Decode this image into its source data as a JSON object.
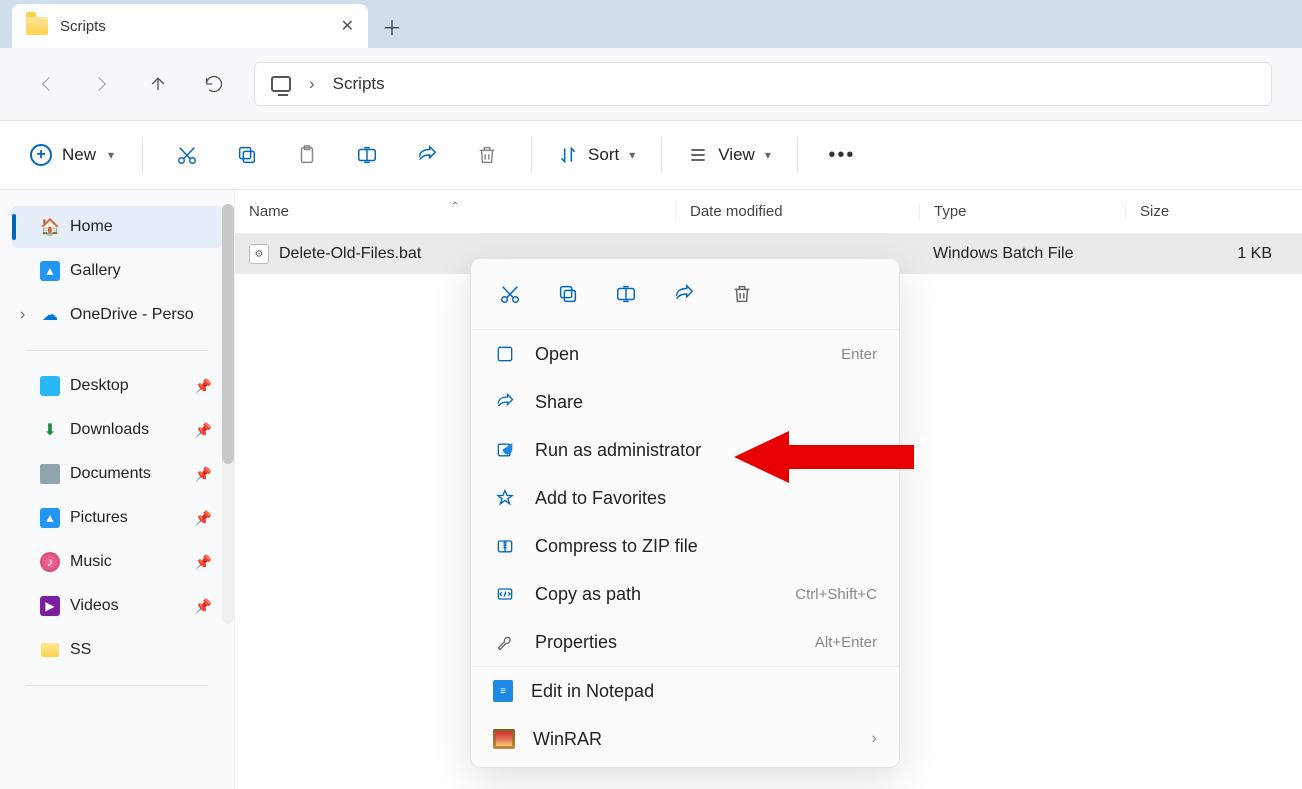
{
  "tab": {
    "title": "Scripts"
  },
  "breadcrumb": {
    "current": "Scripts"
  },
  "toolbar": {
    "new": "New",
    "sort": "Sort",
    "view": "View"
  },
  "sidebar": {
    "items": [
      {
        "label": "Home"
      },
      {
        "label": "Gallery"
      },
      {
        "label": "OneDrive - Perso"
      },
      {
        "label": "Desktop"
      },
      {
        "label": "Downloads"
      },
      {
        "label": "Documents"
      },
      {
        "label": "Pictures"
      },
      {
        "label": "Music"
      },
      {
        "label": "Videos"
      },
      {
        "label": "SS"
      }
    ]
  },
  "columns": {
    "name": "Name",
    "date": "Date modified",
    "type": "Type",
    "size": "Size"
  },
  "files": [
    {
      "name": "Delete-Old-Files.bat",
      "date": "",
      "type": "Windows Batch File",
      "size": "1 KB"
    }
  ],
  "ctx": {
    "open": "Open",
    "open_hint": "Enter",
    "share": "Share",
    "runadmin": "Run as administrator",
    "fav": "Add to Favorites",
    "zip": "Compress to ZIP file",
    "copypath": "Copy as path",
    "copypath_hint": "Ctrl+Shift+C",
    "props": "Properties",
    "props_hint": "Alt+Enter",
    "notepad": "Edit in Notepad",
    "winrar": "WinRAR"
  }
}
